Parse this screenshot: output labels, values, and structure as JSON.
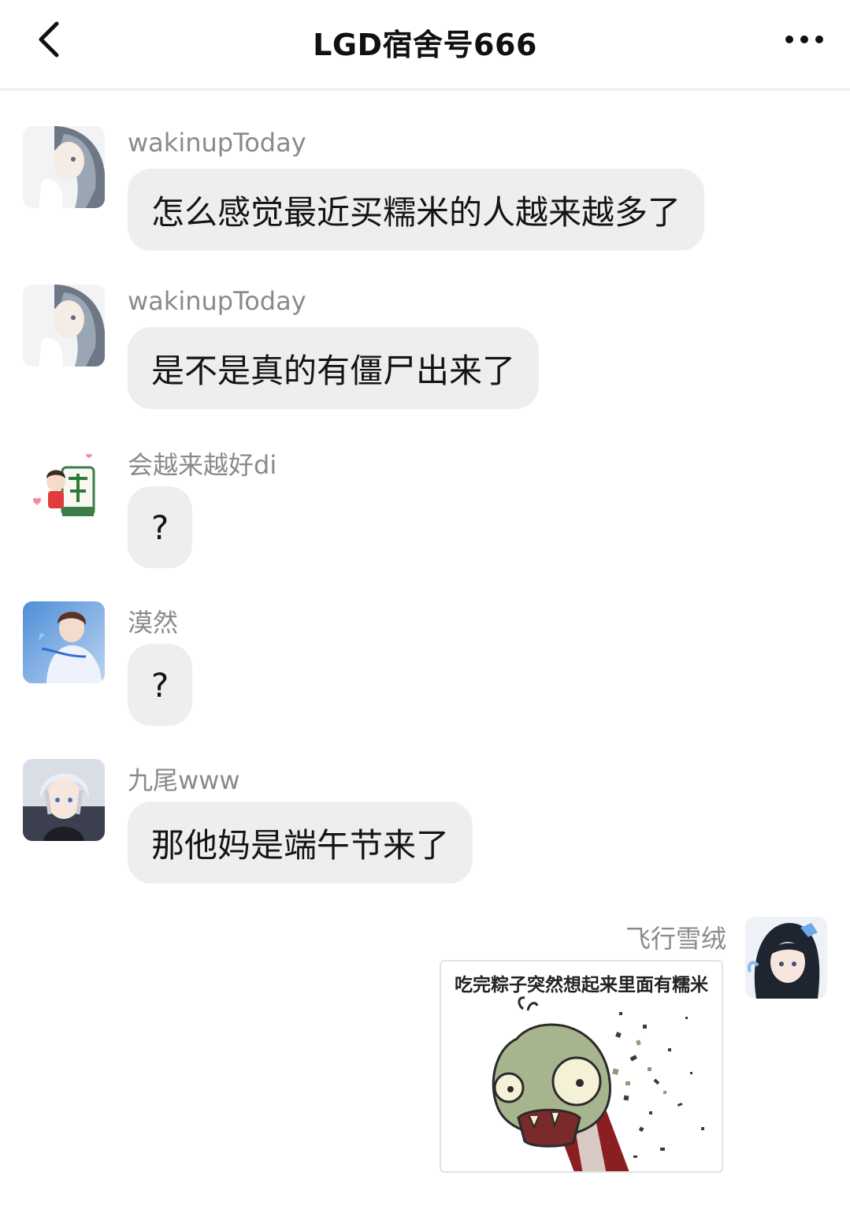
{
  "header": {
    "title": "LGD宿舍号666",
    "back_icon": "chevron-left-icon",
    "more_icon": "more-dots-icon"
  },
  "messages": [
    {
      "sender": "wakinupToday",
      "text": "怎么感觉最近买糯米的人越来越多了",
      "avatar": "anime-silver-hair-avatar"
    },
    {
      "sender": "wakinupToday",
      "text": "是不是真的有僵尸出来了",
      "avatar": "anime-silver-hair-avatar"
    },
    {
      "sender": "会越来越好di",
      "text": "?",
      "avatar": "mahjong-fa-cartoon-avatar"
    },
    {
      "sender": "漠然",
      "text": "?",
      "avatar": "anime-boy-blue-avatar"
    },
    {
      "sender": "九尾www",
      "text": "那他妈是端午节来了",
      "avatar": "anime-white-hair-boy-avatar"
    },
    {
      "sender": "飞行雪绒",
      "sticker_caption": "吃完粽子突然想起来里面有糯米",
      "sticker_image": "zombie-disintegrating-sticker",
      "avatar": "anime-dark-hair-girl-avatar",
      "outgoing": true
    }
  ],
  "colors": {
    "bubble_bg": "#eeeeee",
    "sender_name": "#8a8a8a",
    "background": "#ffffff"
  }
}
